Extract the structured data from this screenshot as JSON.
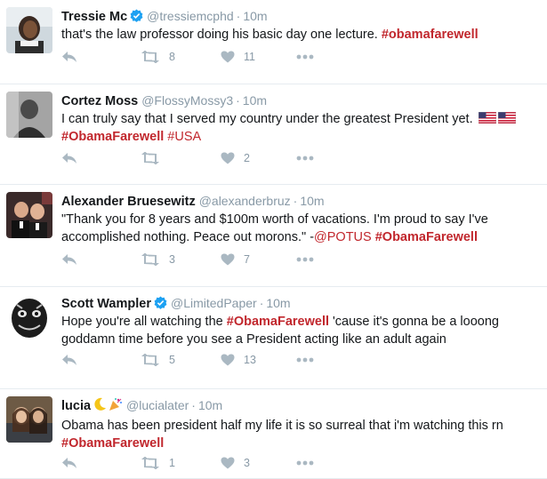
{
  "tweets": [
    {
      "fullname": "Tressie Mc",
      "verified": true,
      "handle": "@tressiemcphd",
      "time": "10m",
      "segments": [
        {
          "kind": "text",
          "value": "that's the law professor doing his basic day one lecture. "
        },
        {
          "kind": "tag",
          "value": "#obamafarewell"
        }
      ],
      "retweets": "8",
      "likes": "11",
      "avatar_icon": "woman-portrait"
    },
    {
      "fullname": "Cortez Moss",
      "verified": false,
      "handle": "@FlossyMossy3",
      "time": "10m",
      "segments": [
        {
          "kind": "text",
          "value": "I can truly say that I served my country under the greatest President yet. "
        },
        {
          "kind": "flags",
          "value": "us-flag-icon"
        },
        {
          "kind": "br",
          "value": ""
        },
        {
          "kind": "tag",
          "value": "#ObamaFarewell"
        },
        {
          "kind": "text",
          "value": " "
        },
        {
          "kind": "tagplain",
          "value": "#USA"
        }
      ],
      "retweets": "",
      "likes": "2",
      "avatar_icon": "man-bw-portrait"
    },
    {
      "fullname": "Alexander Bruesewitz",
      "verified": false,
      "handle": "@alexanderbruz",
      "time": "10m",
      "segments": [
        {
          "kind": "text",
          "value": "\"Thank you for 8 years and $100m worth of vacations. I'm proud to say I've accomplished nothing. Peace out morons.\" -"
        },
        {
          "kind": "mention",
          "value": "@POTUS"
        },
        {
          "kind": "text",
          "value": " "
        },
        {
          "kind": "tag",
          "value": "#ObamaFarewell"
        }
      ],
      "retweets": "3",
      "likes": "7",
      "avatar_icon": "two-men-photo"
    },
    {
      "fullname": "Scott Wampler",
      "verified": true,
      "handle": "@LimitedPaper",
      "time": "10m",
      "segments": [
        {
          "kind": "text",
          "value": "Hope you're all watching the "
        },
        {
          "kind": "tag",
          "value": "#ObamaFarewell"
        },
        {
          "kind": "text",
          "value": " 'cause it's gonna be a looong goddamn time before you see a President acting like an adult again"
        }
      ],
      "retweets": "5",
      "likes": "13",
      "avatar_icon": "creature-mask"
    },
    {
      "fullname": "lucia",
      "verified": false,
      "name_emoji": [
        "moon-emoji",
        "party-popper-emoji"
      ],
      "handle": "@lucialater",
      "time": "10m",
      "segments": [
        {
          "kind": "text",
          "value": "Obama has been president half my life it is so surreal that i'm watching this rn "
        },
        {
          "kind": "br",
          "value": ""
        },
        {
          "kind": "tag",
          "value": "#ObamaFarewell"
        }
      ],
      "retweets": "1",
      "likes": "3",
      "avatar_icon": "two-women-photo"
    }
  ],
  "colors": {
    "hashtag": "#c1272d",
    "muted": "#8899a6",
    "icon": "#aab8c2",
    "divider": "#e6ecf0",
    "verified": "#1da1f2"
  },
  "icons": {
    "reply": "reply-icon",
    "retweet": "retweet-icon",
    "like": "heart-icon",
    "more": "more-icon"
  }
}
